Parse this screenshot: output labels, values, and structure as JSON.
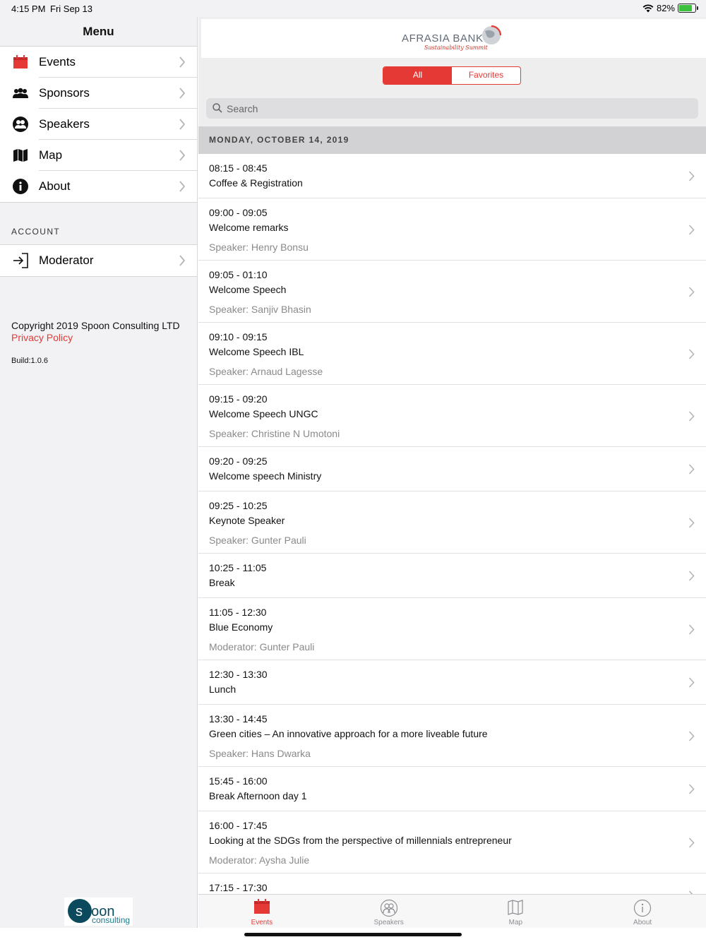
{
  "status": {
    "time": "4:15 PM",
    "date": "Fri Sep 13",
    "battery": "82%",
    "battery_level": 0.82
  },
  "sidebar": {
    "title": "Menu",
    "items": [
      {
        "label": "Events",
        "icon": "calendar-icon"
      },
      {
        "label": "Sponsors",
        "icon": "group-icon"
      },
      {
        "label": "Speakers",
        "icon": "speakers-icon"
      },
      {
        "label": "Map",
        "icon": "map-icon"
      },
      {
        "label": "About",
        "icon": "info-icon"
      }
    ],
    "account_header": "ACCOUNT",
    "account_items": [
      {
        "label": "Moderator",
        "icon": "login-icon"
      }
    ],
    "copyright": "Copyright 2019 Spoon Consulting LTD",
    "privacy": "Privacy Policy",
    "build": "Build:1.0.6",
    "footer_logo": {
      "line1": "spoon",
      "line2": "consulting"
    }
  },
  "header": {
    "logo_text": "AFRASIA BANK",
    "logo_sub": "Sustainability Summit",
    "segments": [
      "All",
      "Favorites"
    ],
    "active_segment": "All",
    "search_placeholder": "Search"
  },
  "date_header": "MONDAY, OCTOBER 14, 2019",
  "events": [
    {
      "time": "08:15 - 08:45",
      "title": "Coffee & Registration",
      "speaker": ""
    },
    {
      "time": "09:00 - 09:05",
      "title": "Welcome remarks",
      "speaker": "Speaker: Henry Bonsu"
    },
    {
      "time": "09:05 - 01:10",
      "title": "Welcome Speech",
      "speaker": "Speaker: Sanjiv Bhasin"
    },
    {
      "time": "09:10 - 09:15",
      "title": "Welcome Speech IBL",
      "speaker": "Speaker: Arnaud Lagesse"
    },
    {
      "time": "09:15 - 09:20",
      "title": "Welcome Speech UNGC",
      "speaker": "Speaker: Christine N Umotoni"
    },
    {
      "time": "09:20 - 09:25",
      "title": "Welcome speech Ministry",
      "speaker": ""
    },
    {
      "time": "09:25 - 10:25",
      "title": "Keynote Speaker",
      "speaker": "Speaker: Gunter Pauli"
    },
    {
      "time": "10:25 - 11:05",
      "title": "Break",
      "speaker": ""
    },
    {
      "time": "11:05 - 12:30",
      "title": "Blue Economy",
      "speaker": "Moderator: Gunter Pauli"
    },
    {
      "time": "12:30 - 13:30",
      "title": "Lunch",
      "speaker": ""
    },
    {
      "time": "13:30 - 14:45",
      "title": "Green cities – An innovative approach for a more liveable future",
      "speaker": "Speaker: Hans Dwarka"
    },
    {
      "time": "15:45 - 16:00",
      "title": "Break Afternoon day 1",
      "speaker": ""
    },
    {
      "time": "16:00 - 17:45",
      "title": "Looking at the SDGs from the perspective of millennials entrepreneur",
      "speaker": "Moderator: Aysha Julie"
    },
    {
      "time": "17:15 - 17:30",
      "title": "",
      "speaker": ""
    }
  ],
  "tabs": [
    {
      "label": "Events",
      "icon": "calendar-icon",
      "active": true
    },
    {
      "label": "Speakers",
      "icon": "speakers-icon",
      "active": false
    },
    {
      "label": "Map",
      "icon": "map-icon",
      "active": false
    },
    {
      "label": "About",
      "icon": "info-icon",
      "active": false
    }
  ],
  "colors": {
    "accent": "#e53935",
    "sidebar_bg": "#f2f2f4",
    "date_header_bg": "#d2d2d4"
  }
}
